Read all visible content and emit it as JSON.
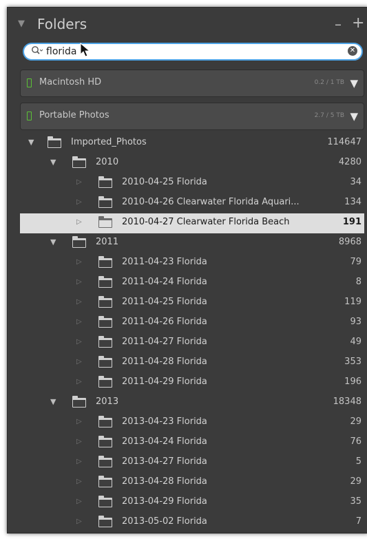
{
  "header": {
    "title": "Folders",
    "collapse_symbol": "▼",
    "minus": "–",
    "plus": "+"
  },
  "search": {
    "value": "florida",
    "icon": "search-icon",
    "clear_icon": "clear-icon"
  },
  "volumes": [
    {
      "name": "Macintosh HD",
      "size": "0.2 / 1 TB",
      "status_color": "#5bc236"
    },
    {
      "name": "Portable Photos",
      "size": "2.7 / 5 TB",
      "status_color": "#5bc236"
    }
  ],
  "tree": {
    "root": {
      "label": "Imported_Photos",
      "count": "114647"
    },
    "years": [
      {
        "label": "2010",
        "count": "4280",
        "folders": [
          {
            "label": "2010-04-25 Florida",
            "count": "34"
          },
          {
            "label": "2010-04-26 Clearwater Florida Aquari...",
            "count": "134"
          },
          {
            "label": "2010-04-27 Clearwater Florida Beach",
            "count": "191",
            "selected": true
          }
        ]
      },
      {
        "label": "2011",
        "count": "8968",
        "folders": [
          {
            "label": "2011-04-23 Florida",
            "count": "79"
          },
          {
            "label": "2011-04-24 Florida",
            "count": "8"
          },
          {
            "label": "2011-04-25 Florida",
            "count": "119"
          },
          {
            "label": "2011-04-26 Florida",
            "count": "93"
          },
          {
            "label": "2011-04-27 Florida",
            "count": "49"
          },
          {
            "label": "2011-04-28 Florida",
            "count": "353"
          },
          {
            "label": "2011-04-29 Florida",
            "count": "196"
          }
        ]
      },
      {
        "label": "2013",
        "count": "18348",
        "folders": [
          {
            "label": "2013-04-23 Florida",
            "count": "29"
          },
          {
            "label": "2013-04-24 Florida",
            "count": "76"
          },
          {
            "label": "2013-04-27 Florida",
            "count": "5"
          },
          {
            "label": "2013-04-28 Florida",
            "count": "29"
          },
          {
            "label": "2013-04-29 Florida",
            "count": "35"
          },
          {
            "label": "2013-05-02 Florida",
            "count": "7"
          }
        ]
      }
    ]
  }
}
